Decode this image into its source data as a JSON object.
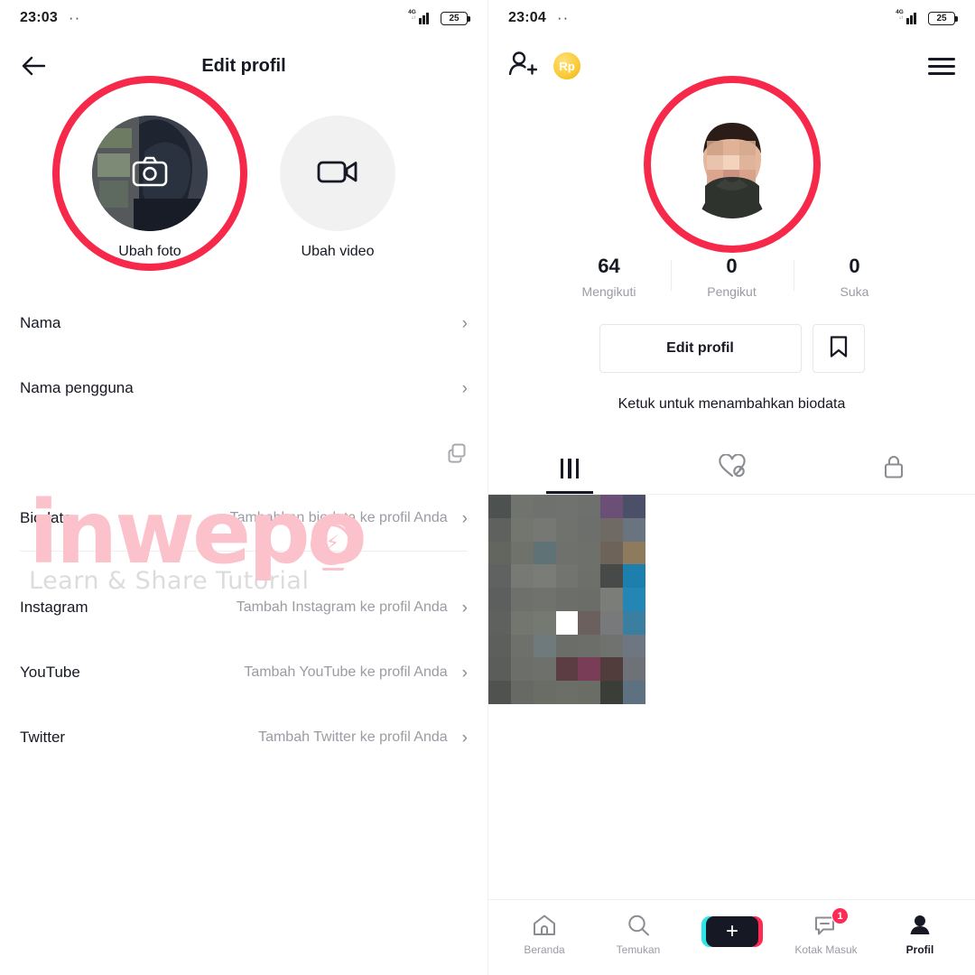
{
  "left": {
    "statusbar": {
      "time": "23:03",
      "dots": "··",
      "network": "4G",
      "battery": "25"
    },
    "nav": {
      "back_icon": "back-arrow-icon",
      "title": "Edit profil"
    },
    "avatars": [
      {
        "label": "Ubah foto",
        "icon": "camera-icon",
        "highlighted": "true"
      },
      {
        "label": "Ubah video",
        "icon": "video-camera-icon",
        "highlighted": "false"
      }
    ],
    "rows": [
      {
        "label": "Nama",
        "value": "",
        "chevron": "›"
      },
      {
        "label": "Nama pengguna",
        "value": "",
        "chevron": "›"
      },
      {
        "label": "Biodata",
        "value": "Tambahkan biodata ke profil Anda",
        "chevron": "›"
      },
      {
        "label": "Instagram",
        "value": "Tambah Instagram ke profil Anda",
        "chevron": "›"
      },
      {
        "label": "YouTube",
        "value": "Tambah YouTube ke profil Anda",
        "chevron": "›"
      },
      {
        "label": "Twitter",
        "value": "Tambah Twitter ke profil Anda",
        "chevron": "›"
      }
    ],
    "copy_icon": "copy-icon"
  },
  "watermark": {
    "brand": "inwepo",
    "tagline": "Learn & Share Tutorial",
    "brand_color": "#fbc2cb",
    "tagline_color": "#dcdcdc"
  },
  "right": {
    "statusbar": {
      "time": "23:04",
      "dots": "··",
      "network": "4G",
      "battery": "25"
    },
    "nav": {
      "add_user_icon": "add-person-icon",
      "coin_label": "Rp",
      "menu_icon": "hamburger-menu-icon"
    },
    "avatar": {
      "highlighted": "true"
    },
    "stats": [
      {
        "value": "64",
        "label": "Mengikuti"
      },
      {
        "value": "0",
        "label": "Pengikut"
      },
      {
        "value": "0",
        "label": "Suka"
      }
    ],
    "actions": {
      "edit_label": "Edit profil",
      "bookmark_icon": "bookmark-icon"
    },
    "bio_hint": "Ketuk untuk menambahkan biodata",
    "tabs": [
      {
        "icon": "grid-icon",
        "active": "true"
      },
      {
        "icon": "heart-off-icon",
        "active": "false"
      },
      {
        "icon": "lock-icon",
        "active": "false"
      }
    ],
    "bottomnav": [
      {
        "label": "Beranda",
        "icon": "home-icon",
        "active": "false",
        "badge": ""
      },
      {
        "label": "Temukan",
        "icon": "search-icon",
        "active": "false",
        "badge": ""
      },
      {
        "label": "",
        "icon": "create-plus-icon",
        "active": "false",
        "badge": ""
      },
      {
        "label": "Kotak Masuk",
        "icon": "inbox-icon",
        "active": "false",
        "badge": "1"
      },
      {
        "label": "Profil",
        "icon": "person-icon",
        "active": "true",
        "badge": ""
      }
    ]
  },
  "colors": {
    "accent_red": "#f6294a",
    "tiktok_pink": "#fe2c55",
    "tiktok_cyan": "#2ce5e9",
    "coin_gold": "#fbcc3b"
  }
}
